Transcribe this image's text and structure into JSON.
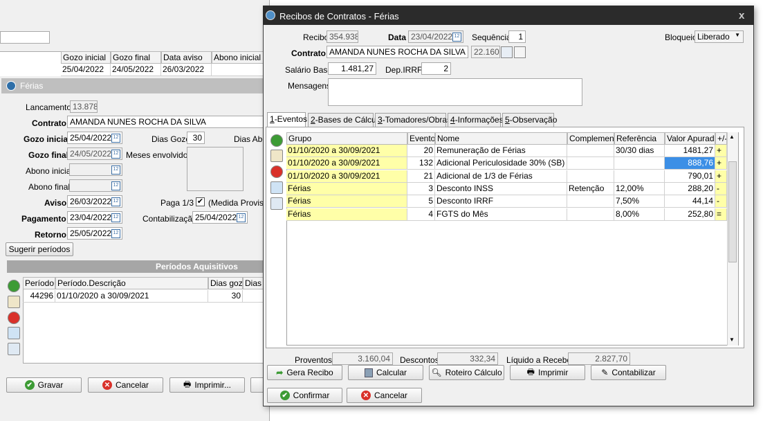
{
  "bg": {
    "grid_headers": [
      "Gozo inicial",
      "Gozo final",
      "Data aviso",
      "Abono inicial"
    ],
    "grid_row": [
      "25/04/2022",
      "24/05/2022",
      "26/03/2022",
      ""
    ]
  },
  "ferias": {
    "title": "Férias",
    "lancamento_label": "Lancamento",
    "lancamento": "13.878",
    "contrato_label": "Contrato",
    "contrato": "AMANDA NUNES ROCHA DA SILVA",
    "gozo_inicial_label": "Gozo inicial",
    "gozo_inicial": "25/04/2022",
    "dias_gozo_label": "Dias Gozo",
    "dias_gozo": "30",
    "dias_abono_label": "Dias Abo",
    "gozo_final_label": "Gozo final",
    "gozo_final": "24/05/2022",
    "meses_label": "Meses envolvidos",
    "abono_inicial_label": "Abono inicial",
    "abono_final_label": "Abono final",
    "aviso_label": "Aviso",
    "aviso": "26/03/2022",
    "paga13_label": "Paga 1/3",
    "medida_label": "(Medida Provisó",
    "pagamento_label": "Pagamento",
    "pagamento": "23/04/2022",
    "contab_label": "Contabilização",
    "contab": "25/04/2022",
    "retorno_label": "Retorno",
    "retorno": "25/05/2022",
    "sugerir": "Sugerir períodos",
    "periodos_title": "Períodos Aquisitivos",
    "per_headers": [
      "Período",
      "Período.Descrição",
      "Dias gozo",
      "Dias a"
    ],
    "per_row": [
      "44296",
      "01/10/2020 a 30/09/2021",
      "30",
      ""
    ],
    "gravar": "Gravar",
    "cancelar": "Cancelar",
    "imprimir": "Imprimir..."
  },
  "recibo": {
    "title": "Recibos de Contratos - Férias",
    "recibo_label": "Recibo",
    "recibo": "354.938",
    "data_label": "Data",
    "data": "23/04/2022",
    "sequencia_label": "Sequência",
    "sequencia": "1",
    "bloqueio_label": "Bloqueio",
    "bloqueio": "Liberado",
    "contrato_label": "Contrato",
    "contrato": "AMANDA NUNES ROCHA DA SILVA",
    "contrato_num": "22.160",
    "salario_label": "Salário Base",
    "salario": "1.481,27",
    "dep_label": "Dep.IRRF",
    "dep": "2",
    "mensagens_label": "Mensagens",
    "tabs": [
      {
        "key": "1",
        "label": "-Eventos"
      },
      {
        "key": "2",
        "label": "-Bases de Cálculo"
      },
      {
        "key": "3",
        "label": "-Tomadores/Obras"
      },
      {
        "key": "4",
        "label": "-Informações"
      },
      {
        "key": "5",
        "label": "-Observação"
      }
    ],
    "headers": [
      "Grupo",
      "Evento",
      "Nome",
      "Complemento",
      "Referência",
      "Valor Apurado",
      "+/-"
    ],
    "rows": [
      [
        "01/10/2020 a 30/09/2021",
        "20",
        "Remuneração de Férias",
        "",
        "30/30 dias",
        "1481,27",
        "+"
      ],
      [
        "01/10/2020 a 30/09/2021",
        "132",
        "Adicional Periculosidade 30% (SB)",
        "",
        "",
        "888,76",
        "+"
      ],
      [
        "01/10/2020 a 30/09/2021",
        "21",
        "Adicional de 1/3 de Férias",
        "",
        "",
        "790,01",
        "+"
      ],
      [
        "Férias",
        "3",
        "Desconto INSS",
        "Retenção",
        "12,00%",
        "288,20",
        "-"
      ],
      [
        "Férias",
        "5",
        "Desconto IRRF",
        "",
        "7,50%",
        "44,14",
        "-"
      ],
      [
        "Férias",
        "4",
        "FGTS do Mês",
        "",
        "8,00%",
        "252,80",
        "="
      ]
    ],
    "proventos_label": "Proventos",
    "proventos": "3.160,04",
    "descontos_label": "Descontos",
    "descontos": "332,34",
    "liquido_label": "Líquido a Receber",
    "liquido": "2.827,70",
    "btn_gera": "Gera Recibo",
    "btn_calcular": "Calcular",
    "btn_roteiro": "Roteiro Cálculo",
    "btn_imprimir": "Imprimir",
    "btn_contab": "Contabilizar",
    "btn_confirmar": "Confirmar",
    "btn_cancelar": "Cancelar"
  },
  "colors": {
    "title_bar": "#2b2b2b",
    "yellow": "#ffffa8",
    "selected": "#3c8fe6",
    "accent": "#5a9bd5"
  }
}
